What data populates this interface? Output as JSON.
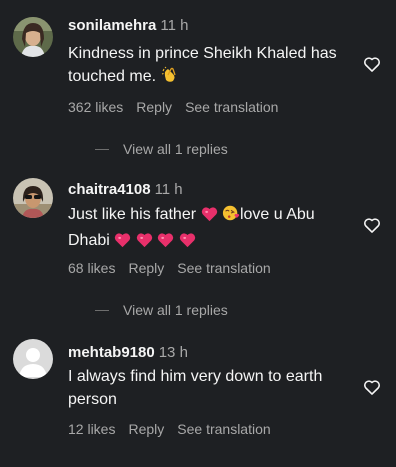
{
  "comments": [
    {
      "username": "sonilamehra",
      "time": "11 h",
      "text_line1": "Kindness in prince Sheikh Khaled has",
      "text_line2": "touched me.",
      "likes": "362 likes",
      "reply": "Reply",
      "translate": "See translation",
      "view_replies": "View all 1 replies",
      "avatar_icon": "profile-photo-woman"
    },
    {
      "username": "chaitra4108",
      "time": "11 h",
      "text_line1_a": "Just like his father",
      "text_line1_b": "love u Abu",
      "text_line2": "Dhabi",
      "likes": "68 likes",
      "reply": "Reply",
      "translate": "See translation",
      "view_replies": "View all 1 replies",
      "avatar_icon": "profile-photo-sunglasses"
    },
    {
      "username": "mehtab9180",
      "time": "13 h",
      "text_line1": "I always find him very down to earth",
      "text_line2": "person",
      "likes": "12 likes",
      "reply": "Reply",
      "translate": "See translation",
      "avatar_icon": "default-avatar"
    }
  ],
  "colors": {
    "background": "#1e2023",
    "text": "#f5f5f5",
    "secondary": "#a8a8a8",
    "heart_emoji": "#e8306b"
  }
}
